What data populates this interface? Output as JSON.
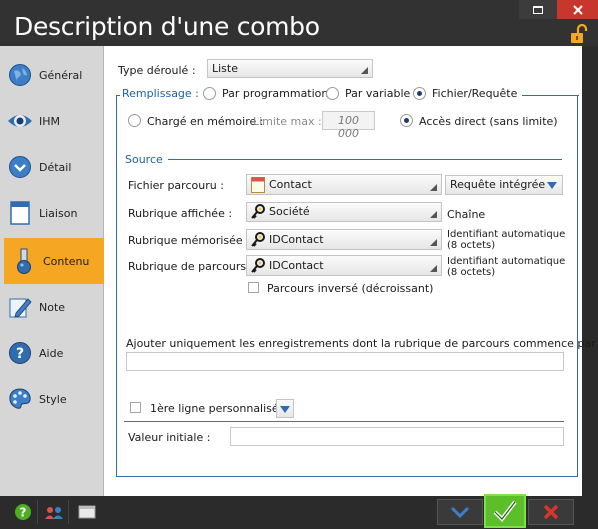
{
  "window": {
    "title": "Description d'une combo"
  },
  "sidebar": {
    "items": [
      {
        "label": "Général",
        "icon": "globe-icon"
      },
      {
        "label": "IHM",
        "icon": "eye-icon"
      },
      {
        "label": "Détail",
        "icon": "chevron-circle-icon"
      },
      {
        "label": "Liaison",
        "icon": "window-icon"
      },
      {
        "label": "Contenu",
        "icon": "flask-icon",
        "active": true
      },
      {
        "label": "Note",
        "icon": "note-pencil-icon"
      },
      {
        "label": "Aide",
        "icon": "help-icon"
      },
      {
        "label": "Style",
        "icon": "palette-icon"
      }
    ]
  },
  "form": {
    "type_label": "Type déroulé :",
    "type_value": "Liste",
    "remplissage_label": "Remplissage :",
    "opt_programmation": "Par programmation",
    "opt_variable": "Par variable",
    "opt_fichier": "Fichier/Requête",
    "opt_charge": "Chargé en mémoire :",
    "limite_label": "Limite max :",
    "limite_value": "100 000",
    "opt_acces": "Accès direct (sans limite)",
    "source_label": "Source",
    "fichier_label": "Fichier parcouru :",
    "fichier_value": "Contact",
    "requete_value": "Requête intégrée",
    "affichee_label": "Rubrique affichée :",
    "affichee_value": "Société",
    "affichee_type": "Chaîne",
    "memorisee_label": "Rubrique mémorisée :",
    "memorisee_value": "IDContact",
    "memorisee_type1": "Identifiant automatique",
    "memorisee_type2": "(8 octets)",
    "parcours_label": "Rubrique de parcours :",
    "parcours_value": "IDContact",
    "parcours_type1": "Identifiant automatique",
    "parcours_type2": "(8 octets)",
    "inverse_label": "Parcours inversé (décroissant)",
    "ajouter_label": "Ajouter uniquement les enregistrements dont la rubrique de parcours commence par :",
    "ajouter_value": "",
    "premiere_label": "1ère ligne personnalisée",
    "valeur_label": "Valeur initiale :",
    "valeur_value": ""
  },
  "colors": {
    "accent": "#f5a623",
    "link": "#1e5fa8",
    "ok": "#4caf22",
    "cancel": "#c8372b"
  }
}
